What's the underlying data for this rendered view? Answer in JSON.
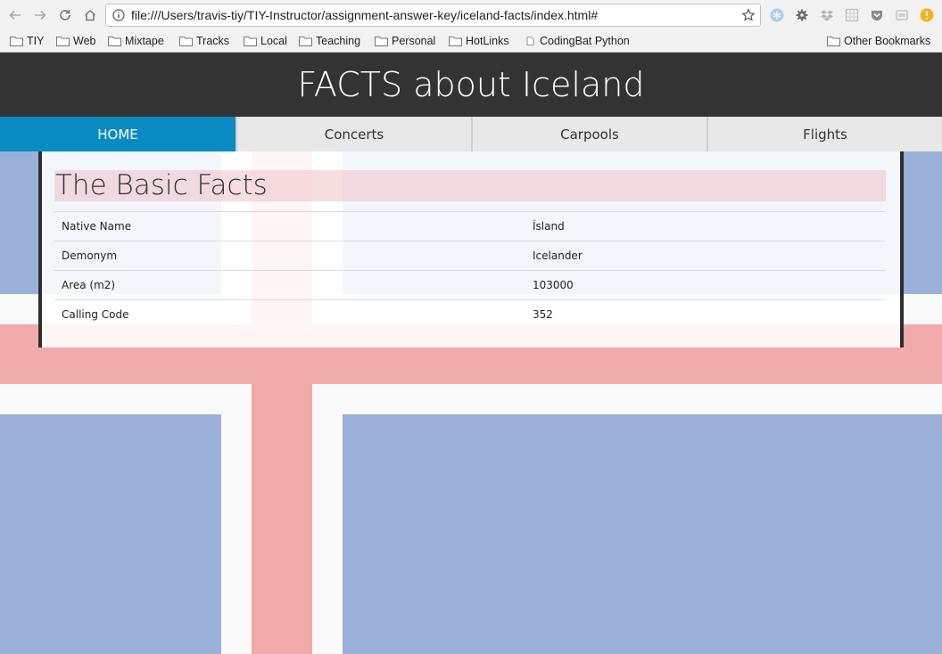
{
  "browser": {
    "url": "file:///Users/travis-tiy/TIY-Instructor/assignment-answer-key/iceland-facts/index.html#",
    "bookmarks": [
      "TIY",
      "Web",
      "Mixtape",
      "Tracks",
      "Local",
      "Teaching",
      "Personal",
      "HotLinks",
      "CodingBat Python"
    ],
    "other_bookmarks": "Other Bookmarks"
  },
  "site": {
    "title": "FACTS about Iceland",
    "nav": [
      {
        "label": "HOME",
        "active": true
      },
      {
        "label": "Concerts",
        "active": false
      },
      {
        "label": "Carpools",
        "active": false
      },
      {
        "label": "Flights",
        "active": false
      }
    ]
  },
  "facts": {
    "heading": "The Basic Facts",
    "rows": [
      {
        "label": "Native Name",
        "value": "Ísland"
      },
      {
        "label": "Demonym",
        "value": "Icelander"
      },
      {
        "label": "Area (m2)",
        "value": "103000"
      },
      {
        "label": "Calling Code",
        "value": "352"
      }
    ]
  },
  "colors": {
    "header_bg": "#333333",
    "nav_active": "#0a8bc2",
    "flag_blue": "#9bb0d8",
    "flag_red": "#f0aaaa"
  }
}
